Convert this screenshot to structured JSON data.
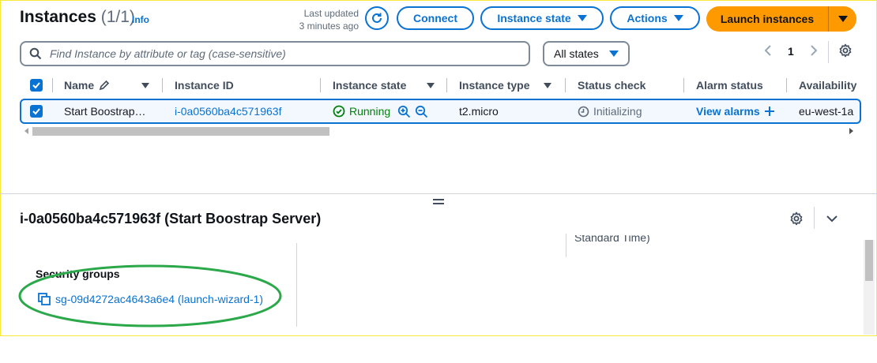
{
  "header": {
    "title": "Instances",
    "count": "(1/1)",
    "info": "Info",
    "last_updated_line1": "Last updated",
    "last_updated_line2": "3 minutes ago",
    "connect": "Connect",
    "instance_state": "Instance state",
    "actions": "Actions",
    "launch": "Launch instances"
  },
  "search": {
    "placeholder": "Find Instance by attribute or tag (case-sensitive)"
  },
  "filter": {
    "selected": "All states"
  },
  "pagination": {
    "page": "1"
  },
  "table": {
    "columns": [
      "Name",
      "Instance ID",
      "Instance state",
      "Instance type",
      "Status check",
      "Alarm status",
      "Availability"
    ],
    "rows": [
      {
        "name": "Start Boostrap…",
        "instance_id": "i-0a0560ba4c571963f",
        "state": "Running",
        "type": "t2.micro",
        "status_check": "Initializing",
        "alarm": "View alarms",
        "availability": "eu-west-1a"
      }
    ]
  },
  "detail": {
    "title": "i-0a0560ba4c571963f (Start Boostrap Server)",
    "partial_text": "Standard Time)",
    "security_groups_label": "Security groups",
    "security_group_link": "sg-09d4272ac4643a6e4 (launch-wizard-1)"
  },
  "colors": {
    "link": "#0972d3",
    "launch": "#ff9900",
    "running": "#037f0c",
    "annotation": "#2ba84a"
  },
  "icons": [
    "refresh-icon",
    "search-icon",
    "caret-down-icon",
    "settings-icon",
    "pencil-icon",
    "zoom-in-icon",
    "zoom-out-icon",
    "check-circle-icon",
    "clock-icon",
    "plus-icon",
    "copy-icon",
    "chevron-down-icon",
    "chevron-left-icon",
    "chevron-right-icon",
    "drag-handle-icon"
  ]
}
